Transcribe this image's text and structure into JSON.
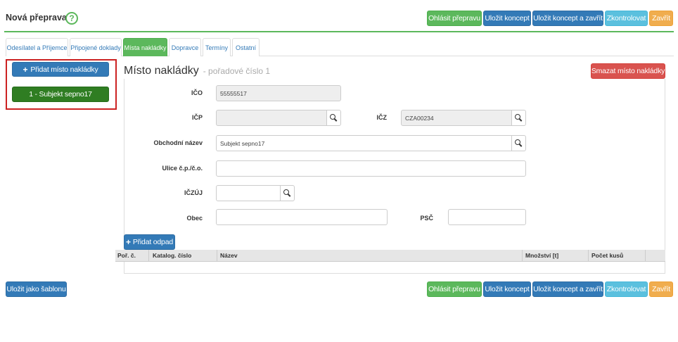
{
  "header": {
    "title": "Nová přeprava",
    "help_icon": "question-circle-icon",
    "help_glyph": "?",
    "buttons": {
      "report": "Ohlásit přepravu",
      "save_draft": "Uložit koncept",
      "save_close": "Uložit koncept a zavřít",
      "check": "Zkontrolovat",
      "close": "Zavřít"
    }
  },
  "tabs": [
    {
      "label": "Odesílatel a Příjemce"
    },
    {
      "label": "Připojené doklady"
    },
    {
      "label": "Místa nakládky"
    },
    {
      "label": "Dopravce"
    },
    {
      "label": "Termíny"
    },
    {
      "label": "Ostatní"
    }
  ],
  "active_tab": "Místa nakládky",
  "sidebar": {
    "add_button": "Přidat místo nakládky",
    "add_icon": "plus-icon",
    "items": [
      {
        "label": "1 - Subjekt sepno17"
      }
    ]
  },
  "main": {
    "heading": "Místo nakládky",
    "subheading": "- pořadové číslo 1",
    "delete_button": "Smazat místo nakládky",
    "form": {
      "ico": {
        "label": "IČO",
        "value": "55555517"
      },
      "icp": {
        "label": "IČP",
        "value": ""
      },
      "icz": {
        "label": "IČZ",
        "value": "CZA00234"
      },
      "name": {
        "label": "Obchodní název",
        "value": "Subjekt sepno17"
      },
      "street": {
        "label": "Ulice č.p./č.o.",
        "value": ""
      },
      "iczuj": {
        "label": "IČZÚJ",
        "value": ""
      },
      "city": {
        "label": "Obec",
        "value": ""
      },
      "psc": {
        "label": "PSČ",
        "value": ""
      }
    },
    "add_waste_button": "Přidat odpad",
    "table": {
      "columns": [
        "Poř. č.",
        "Katalog. číslo",
        "Název",
        "Množství [t]",
        "Počet kusů"
      ],
      "rows": []
    }
  },
  "footer": {
    "save_template": "Uložit jako šablonu"
  },
  "colors": {
    "green": "#5cb85c",
    "blue": "#337ab7",
    "cyan": "#5bc0de",
    "orange": "#f0ad4e",
    "red": "#d9534f",
    "dark_green": "#2f7d22",
    "highlight_border": "#cc2222"
  }
}
